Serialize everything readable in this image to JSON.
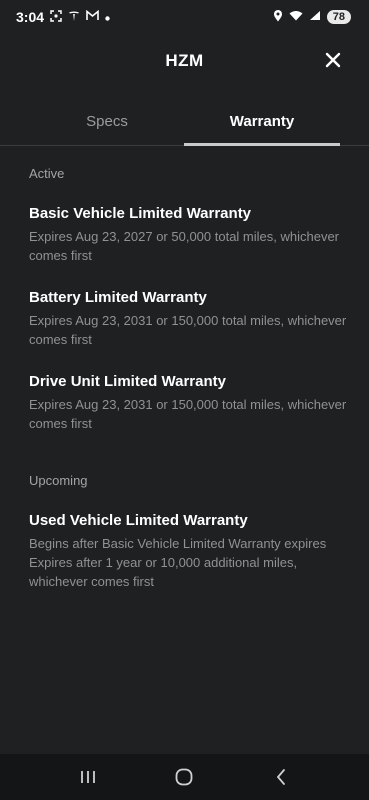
{
  "status": {
    "time": "3:04",
    "battery": "78"
  },
  "header": {
    "title": "HZM"
  },
  "tabs": [
    {
      "label": "Specs",
      "active": false
    },
    {
      "label": "Warranty",
      "active": true
    }
  ],
  "sections": {
    "active": {
      "label": "Active",
      "items": [
        {
          "title": "Basic Vehicle Limited Warranty",
          "desc": "Expires Aug 23, 2027 or 50,000 total miles, whichever comes first"
        },
        {
          "title": "Battery Limited Warranty",
          "desc": "Expires Aug 23, 2031 or 150,000 total miles, whichever comes first"
        },
        {
          "title": "Drive Unit Limited Warranty",
          "desc": "Expires Aug 23, 2031 or 150,000 total miles, whichever comes first"
        }
      ]
    },
    "upcoming": {
      "label": "Upcoming",
      "items": [
        {
          "title": "Used Vehicle Limited Warranty",
          "desc1": "Begins after Basic Vehicle Limited Warranty expires",
          "desc2": "Expires after 1 year or 10,000 additional miles, whichever comes first"
        }
      ]
    }
  },
  "icons": {
    "close": "close-icon",
    "recents": "recents-icon",
    "home": "home-icon",
    "back": "back-icon"
  }
}
